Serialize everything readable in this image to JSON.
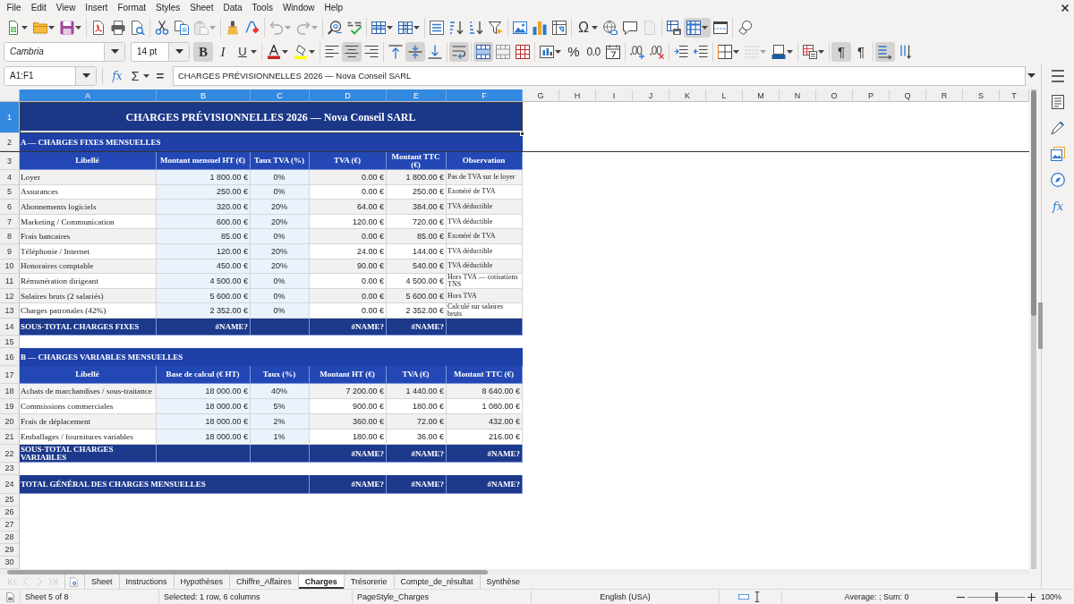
{
  "menu": [
    "File",
    "Edit",
    "View",
    "Insert",
    "Format",
    "Styles",
    "Sheet",
    "Data",
    "Tools",
    "Window",
    "Help"
  ],
  "toolbar_standard": {
    "groups": [
      [
        {
          "kind": "new",
          "pressed": false,
          "disabled": false,
          "dropdown": true
        },
        {
          "kind": "open",
          "pressed": false,
          "disabled": false,
          "dropdown": true
        },
        {
          "kind": "save",
          "pressed": false,
          "disabled": false,
          "dropdown": true
        }
      ],
      [
        {
          "kind": "pdf",
          "pressed": false,
          "disabled": false,
          "dropdown": false
        },
        {
          "kind": "print",
          "pressed": false,
          "disabled": false,
          "dropdown": false
        },
        {
          "kind": "preview",
          "pressed": false,
          "disabled": false,
          "dropdown": false
        }
      ],
      [
        {
          "kind": "cut",
          "pressed": false,
          "disabled": false,
          "dropdown": false
        },
        {
          "kind": "copy",
          "pressed": false,
          "disabled": false,
          "dropdown": false
        },
        {
          "kind": "paste",
          "pressed": false,
          "disabled": true,
          "dropdown": true
        }
      ],
      [
        {
          "kind": "clone",
          "pressed": false,
          "disabled": false,
          "dropdown": false
        },
        {
          "kind": "clear",
          "pressed": false,
          "disabled": false,
          "dropdown": false
        }
      ],
      [
        {
          "kind": "undo",
          "pressed": false,
          "disabled": true,
          "dropdown": true
        },
        {
          "kind": "redo",
          "pressed": false,
          "disabled": true,
          "dropdown": true
        }
      ],
      [
        {
          "kind": "find",
          "pressed": false,
          "disabled": false,
          "dropdown": false
        },
        {
          "kind": "spelling",
          "pressed": false,
          "disabled": false,
          "dropdown": false
        }
      ],
      [
        {
          "kind": "rows",
          "pressed": false,
          "disabled": false,
          "dropdown": true
        },
        {
          "kind": "columns",
          "pressed": false,
          "disabled": false,
          "dropdown": true
        }
      ],
      [
        {
          "kind": "sort",
          "pressed": false,
          "disabled": false,
          "dropdown": false
        },
        {
          "kind": "ascending",
          "pressed": false,
          "disabled": false,
          "dropdown": false
        },
        {
          "kind": "descending",
          "pressed": false,
          "disabled": false,
          "dropdown": false
        },
        {
          "kind": "filter",
          "pressed": false,
          "disabled": false,
          "dropdown": false
        }
      ],
      [
        {
          "kind": "image",
          "pressed": false,
          "disabled": false,
          "dropdown": false
        },
        {
          "kind": "chart",
          "pressed": false,
          "disabled": false,
          "dropdown": false
        },
        {
          "kind": "pivot",
          "pressed": false,
          "disabled": false,
          "dropdown": false
        }
      ],
      [
        {
          "kind": "symbol",
          "glyph": "Ω",
          "pressed": false,
          "disabled": false,
          "dropdown": true
        },
        {
          "kind": "hyperlink",
          "pressed": false,
          "disabled": false,
          "dropdown": false
        },
        {
          "kind": "comment",
          "pressed": false,
          "disabled": false,
          "dropdown": false
        },
        {
          "kind": "headerfooter",
          "pressed": false,
          "disabled": true,
          "dropdown": false
        }
      ],
      [
        {
          "kind": "printarea",
          "pressed": false,
          "disabled": false,
          "dropdown": false
        },
        {
          "kind": "freeze",
          "pressed": true,
          "disabled": false,
          "dropdown": true
        },
        {
          "kind": "split",
          "pressed": false,
          "disabled": false,
          "dropdown": false
        }
      ],
      [
        {
          "kind": "draw",
          "pressed": false,
          "disabled": false,
          "dropdown": false
        }
      ]
    ]
  },
  "toolbar_formatting": {
    "font_name": "Cambria",
    "font_size": "14 pt",
    "groups": [
      [
        {
          "kind": "bold",
          "glyph": "B",
          "pressed": true,
          "disabled": false,
          "dropdown": false
        },
        {
          "kind": "italic",
          "glyph": "I",
          "pressed": false,
          "disabled": false,
          "dropdown": false
        },
        {
          "kind": "underline",
          "glyph": "U",
          "pressed": false,
          "disabled": false,
          "dropdown": true
        }
      ],
      [
        {
          "kind": "fontcolor",
          "pressed": false,
          "disabled": false,
          "dropdown": true
        },
        {
          "kind": "highlight",
          "pressed": false,
          "disabled": false,
          "dropdown": true
        }
      ],
      [
        {
          "kind": "left",
          "pressed": false,
          "disabled": false,
          "dropdown": false
        },
        {
          "kind": "center",
          "pressed": true,
          "disabled": false,
          "dropdown": false
        },
        {
          "kind": "right",
          "pressed": false,
          "disabled": false,
          "dropdown": false
        }
      ],
      [
        {
          "kind": "top",
          "pressed": false,
          "disabled": false,
          "dropdown": false
        },
        {
          "kind": "middle",
          "pressed": true,
          "disabled": false,
          "dropdown": false
        },
        {
          "kind": "bottom",
          "pressed": false,
          "disabled": false,
          "dropdown": false
        }
      ],
      [
        {
          "kind": "wrap",
          "pressed": true,
          "disabled": false,
          "dropdown": false
        }
      ],
      [
        {
          "kind": "mergecenter",
          "pressed": true,
          "disabled": false,
          "dropdown": false
        },
        {
          "kind": "merge",
          "pressed": false,
          "disabled": false,
          "dropdown": false
        },
        {
          "kind": "unmerge",
          "pressed": false,
          "disabled": false,
          "dropdown": false
        }
      ],
      [
        {
          "kind": "currency",
          "pressed": false,
          "disabled": false,
          "dropdown": true
        },
        {
          "kind": "percent",
          "glyph": "%",
          "pressed": false,
          "disabled": false,
          "dropdown": false
        },
        {
          "kind": "number",
          "glyph": "0.0",
          "pressed": false,
          "disabled": false,
          "dropdown": false
        },
        {
          "kind": "date",
          "pressed": false,
          "disabled": false,
          "dropdown": false
        }
      ],
      [
        {
          "kind": "adddecimal",
          "pressed": false,
          "disabled": false,
          "dropdown": false
        },
        {
          "kind": "deletedecimal",
          "pressed": false,
          "disabled": false,
          "dropdown": false
        }
      ],
      [
        {
          "kind": "indent",
          "pressed": false,
          "disabled": false,
          "dropdown": false
        },
        {
          "kind": "outdent",
          "pressed": false,
          "disabled": false,
          "dropdown": false
        }
      ],
      [
        {
          "kind": "borders",
          "pressed": false,
          "disabled": false,
          "dropdown": true
        },
        {
          "kind": "borderstyle",
          "pressed": false,
          "disabled": true,
          "dropdown": true
        },
        {
          "kind": "bordercolor",
          "pressed": false,
          "disabled": false,
          "dropdown": true
        }
      ],
      [
        {
          "kind": "conditional",
          "pressed": false,
          "disabled": false,
          "dropdown": true
        }
      ],
      [
        {
          "kind": "ltr",
          "glyph": "¶",
          "pressed": true,
          "disabled": false,
          "dropdown": false
        },
        {
          "kind": "rtl",
          "glyph": "¶",
          "pressed": false,
          "disabled": false,
          "dropdown": false
        }
      ],
      [
        {
          "kind": "textdirection",
          "pressed": true,
          "disabled": false,
          "dropdown": false
        },
        {
          "kind": "vertical",
          "pressed": false,
          "disabled": false,
          "dropdown": false
        }
      ]
    ]
  },
  "formula_bar": {
    "name_box": "A1:F1",
    "buttons": [
      {
        "kind": "function",
        "glyph": "fx",
        "dropdown": false
      },
      {
        "kind": "sum",
        "glyph": "Σ",
        "dropdown": true
      },
      {
        "kind": "formula",
        "glyph": "=",
        "dropdown": false
      }
    ],
    "formula": "CHARGES PRÉVISIONNELLES 2026 — Nova Conseil SARL"
  },
  "sheet": {
    "columns": [
      {
        "label": "A",
        "selected": true
      },
      {
        "label": "B",
        "selected": true
      },
      {
        "label": "C",
        "selected": true
      },
      {
        "label": "D",
        "selected": true
      },
      {
        "label": "E",
        "selected": true
      },
      {
        "label": "F",
        "selected": true
      },
      {
        "label": "G",
        "selected": false
      },
      {
        "label": "H",
        "selected": false
      },
      {
        "label": "I",
        "selected": false
      },
      {
        "label": "J",
        "selected": false
      },
      {
        "label": "K",
        "selected": false
      },
      {
        "label": "L",
        "selected": false
      },
      {
        "label": "M",
        "selected": false
      },
      {
        "label": "N",
        "selected": false
      },
      {
        "label": "O",
        "selected": false
      },
      {
        "label": "P",
        "selected": false
      },
      {
        "label": "Q",
        "selected": false
      },
      {
        "label": "R",
        "selected": false
      },
      {
        "label": "S",
        "selected": false
      },
      {
        "label": "T",
        "selected": false
      }
    ],
    "rows": [
      {
        "number": "1",
        "selected": true,
        "kind": "title",
        "cells": {
          "A": "CHARGES PRÉVISIONNELLES 2026 — Nova Conseil SARL"
        }
      },
      {
        "number": "2",
        "selected": false,
        "kind": "section",
        "cells": {
          "A": "A — CHARGES FIXES MENSUELLES"
        }
      },
      {
        "kind": "divider"
      },
      {
        "number": "3",
        "selected": false,
        "kind": "header",
        "cells": {
          "A": "Libellé",
          "B": "Montant mensuel HT (€)",
          "C": "Taux TVA (%)",
          "D": "TVA (€)",
          "E": "Montant TTC (€)",
          "F": "Observation"
        }
      },
      {
        "number": "4",
        "selected": false,
        "kind": "fixed",
        "cells": {
          "A": "Loyer",
          "B": "1 800.00 €",
          "C": "0%",
          "D": "0.00 €",
          "E": "1 800.00 €",
          "F": "Pas de TVA sur le loyer"
        }
      },
      {
        "number": "5",
        "selected": false,
        "kind": "fixed",
        "cells": {
          "A": "Assurances",
          "B": "250.00 €",
          "C": "0%",
          "D": "0.00 €",
          "E": "250.00 €",
          "F": "Exonéré de TVA"
        }
      },
      {
        "number": "6",
        "selected": false,
        "kind": "fixed",
        "cells": {
          "A": "Abonnements logiciels",
          "B": "320.00 €",
          "C": "20%",
          "D": "64.00 €",
          "E": "384.00 €",
          "F": "TVA déductible"
        }
      },
      {
        "number": "7",
        "selected": false,
        "kind": "fixed",
        "cells": {
          "A": "Marketing / Communication",
          "B": "600.00 €",
          "C": "20%",
          "D": "120.00 €",
          "E": "720.00 €",
          "F": "TVA déductible"
        }
      },
      {
        "number": "8",
        "selected": false,
        "kind": "fixed",
        "cells": {
          "A": "Frais bancaires",
          "B": "85.00 €",
          "C": "0%",
          "D": "0.00 €",
          "E": "85.00 €",
          "F": "Exonéré de TVA"
        }
      },
      {
        "number": "9",
        "selected": false,
        "kind": "fixed",
        "cells": {
          "A": "Téléphonie / Internet",
          "B": "120.00 €",
          "C": "20%",
          "D": "24.00 €",
          "E": "144.00 €",
          "F": "TVA déductible"
        }
      },
      {
        "number": "10",
        "selected": false,
        "kind": "fixed",
        "cells": {
          "A": "Honoraires comptable",
          "B": "450.00 €",
          "C": "20%",
          "D": "90.00 €",
          "E": "540.00 €",
          "F": "TVA déductible"
        }
      },
      {
        "number": "11",
        "selected": false,
        "kind": "fixed",
        "cells": {
          "A": "Rémunération dirigeant",
          "B": "4 500.00 €",
          "C": "0%",
          "D": "0.00 €",
          "E": "4 500.00 €",
          "F": "Hors TVA — cotisations TNS"
        }
      },
      {
        "number": "12",
        "selected": false,
        "kind": "fixed",
        "cells": {
          "A": "Salaires bruts (2 salariés)",
          "B": "5 600.00 €",
          "C": "0%",
          "D": "0.00 €",
          "E": "5 600.00 €",
          "F": "Hors TVA"
        }
      },
      {
        "number": "13",
        "selected": false,
        "kind": "fixed",
        "cells": {
          "A": "Charges patronales (42%)",
          "B": "2 352.00 €",
          "C": "0%",
          "D": "0.00 €",
          "E": "2 352.00 €",
          "F": "Calculé sur salaires bruts"
        }
      },
      {
        "number": "14",
        "selected": false,
        "kind": "subtotal",
        "cells": {
          "A": "SOUS-TOTAL CHARGES FIXES",
          "B": "#NAME?",
          "D": "#NAME?",
          "E": "#NAME?"
        }
      },
      {
        "number": "15",
        "selected": false,
        "kind": "empty"
      },
      {
        "number": "16",
        "selected": false,
        "kind": "section",
        "cells": {
          "A": "B — CHARGES VARIABLES MENSUELLES"
        }
      },
      {
        "number": "17",
        "selected": false,
        "kind": "header",
        "cells": {
          "A": "Libellé",
          "B": "Base de calcul (€ HT)",
          "C": "Taux (%)",
          "D": "Montant HT (€)",
          "E": "TVA (€)",
          "F": "Montant TTC (€)"
        }
      },
      {
        "number": "18",
        "selected": false,
        "kind": "variable",
        "cells": {
          "A": "Achats de marchandises / sous-traitance",
          "B": "18 000.00 €",
          "C": "40%",
          "D": "7 200.00 €",
          "E": "1 440.00 €",
          "F": "8 640.00 €"
        }
      },
      {
        "number": "19",
        "selected": false,
        "kind": "variable",
        "cells": {
          "A": "Commissions commerciales",
          "B": "18 000.00 €",
          "C": "5%",
          "D": "900.00 €",
          "E": "180.00 €",
          "F": "1 080.00 €"
        }
      },
      {
        "number": "20",
        "selected": false,
        "kind": "variable",
        "cells": {
          "A": "Frais de déplacement",
          "B": "18 000.00 €",
          "C": "2%",
          "D": "360.00 €",
          "E": "72.00 €",
          "F": "432.00 €"
        }
      },
      {
        "number": "21",
        "selected": false,
        "kind": "variable",
        "cells": {
          "A": "Emballages / fournitures variables",
          "B": "18 000.00 €",
          "C": "1%",
          "D": "180.00 €",
          "E": "36.00 €",
          "F": "216.00 €"
        }
      },
      {
        "number": "22",
        "selected": false,
        "kind": "subtotal",
        "cells": {
          "A": "SOUS-TOTAL CHARGES VARIABLES",
          "D": "#NAME?",
          "E": "#NAME?",
          "F": "#NAME?"
        }
      },
      {
        "number": "23",
        "selected": false,
        "kind": "empty"
      },
      {
        "number": "24",
        "selected": false,
        "kind": "total",
        "cells": {
          "A": "TOTAL GÉNÉRAL DES CHARGES MENSUELLES",
          "D": "#NAME?",
          "E": "#NAME?",
          "F": "#NAME?"
        }
      },
      {
        "number": "25",
        "selected": false,
        "kind": "empty"
      },
      {
        "number": "26",
        "selected": false,
        "kind": "empty"
      },
      {
        "number": "27",
        "selected": false,
        "kind": "empty"
      },
      {
        "number": "28",
        "selected": false,
        "kind": "empty"
      },
      {
        "number": "29",
        "selected": false,
        "kind": "empty"
      },
      {
        "number": "30",
        "selected": false,
        "kind": "empty"
      }
    ]
  },
  "sheet_tabs": {
    "navigation": [
      {
        "kind": "first",
        "disabled": true
      },
      {
        "kind": "previous",
        "disabled": true
      },
      {
        "kind": "next",
        "disabled": true
      },
      {
        "kind": "last",
        "disabled": true
      }
    ],
    "tabs": [
      {
        "label": "Sheet",
        "selected": false
      },
      {
        "label": "Instructions",
        "selected": false
      },
      {
        "label": "Hypothèses",
        "selected": false
      },
      {
        "label": "Chiffre_Affaires",
        "selected": false
      },
      {
        "label": "Charges",
        "selected": true
      },
      {
        "label": "Trésorerie",
        "selected": false
      },
      {
        "label": "Compte_de_résultat",
        "selected": false
      },
      {
        "label": "Synthèse",
        "selected": false
      }
    ]
  },
  "sidebar": {
    "buttons": [
      {
        "kind": "menu"
      },
      {
        "kind": "properties"
      },
      {
        "kind": "styles"
      },
      {
        "kind": "gallery"
      },
      {
        "kind": "navigator"
      },
      {
        "kind": "functions",
        "glyph": "fx"
      }
    ]
  },
  "status_bar": {
    "sheet_position": "Sheet 5 of 8",
    "selection": "Selected: 1 row, 6 columns",
    "page_style": "PageStyle_Charges",
    "language": "English (USA)",
    "summary": "Average: ; Sum: 0",
    "zoom": {
      "level": 0.5,
      "reading": "100%"
    }
  }
}
